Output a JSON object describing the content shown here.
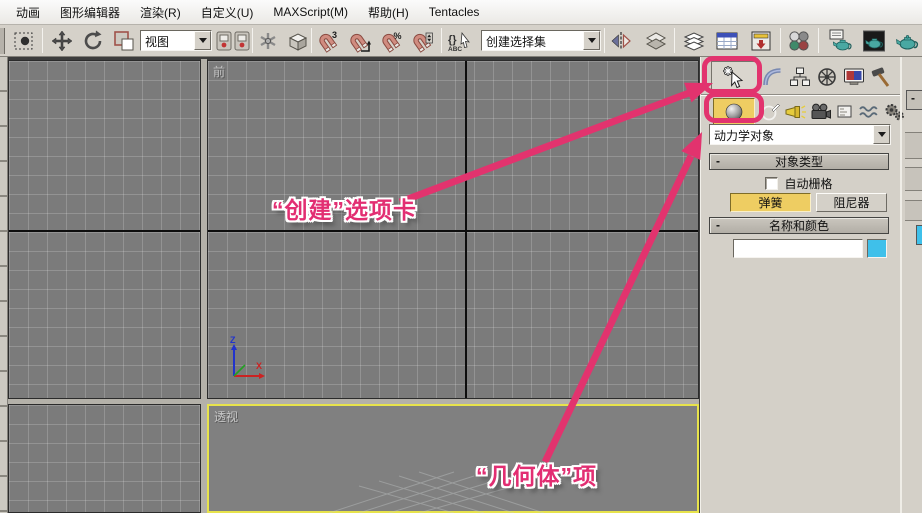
{
  "menu_bar": {
    "items": [
      "动画",
      "图形编辑器",
      "渲染(R)",
      "自定义(U)",
      "MAXScript(M)",
      "帮助(H)",
      "Tentacles"
    ]
  },
  "toolbar": {
    "view_dropdown_value": "视图",
    "selection_set_dropdown_value": "创建选择集",
    "glyphs": {
      "three": "3",
      "percent": "%",
      "braces": "{}",
      "abc": "ABC"
    },
    "icons": [
      "region-select",
      "select-and-move",
      "select-and-rotate",
      "select-and-scale",
      "use-pivot-point-center",
      "select-and-manipulate",
      "keyboard-shortcut-override",
      "3d-snap-toggle",
      "angle-snap-toggle",
      "percent-snap-toggle",
      "spinner-snap-toggle",
      "named-selection-sets",
      "mirror",
      "align",
      "layer-manager",
      "curve-editor",
      "schematic-view",
      "material-editor",
      "render-setup",
      "rendered-frame-window",
      "render-production"
    ]
  },
  "viewports": {
    "front_label": "前",
    "perspective_label": "透视",
    "axis": {
      "x": "X",
      "z": "Z"
    }
  },
  "command_panel": {
    "tabs": [
      "create",
      "modify",
      "hierarchy",
      "motion",
      "display",
      "utilities"
    ],
    "active_tab": "create",
    "categories": [
      "geometry",
      "shapes",
      "lights",
      "cameras",
      "helpers",
      "space-warps",
      "systems"
    ],
    "active_category": "geometry",
    "category_dropdown_value": "动力学对象",
    "object_type_rollout": {
      "collapse_glyph": "-",
      "title": "对象类型",
      "autogrid_label": "自动栅格",
      "autogrid_checked": false,
      "buttons": [
        {
          "label": "弹簧",
          "active": true
        },
        {
          "label": "阻尼器",
          "active": false
        }
      ]
    },
    "name_color_rollout": {
      "collapse_glyph": "-",
      "title": "名称和颜色",
      "name_value": "",
      "color_swatch": "#3FC0EA"
    },
    "right_strip": {
      "collapse_glyph": "-"
    }
  },
  "annotations": {
    "accent_color": "#E2336E",
    "create_tab_callout": "“创建”选项卡",
    "geometry_item_callout": "“几何体”项"
  }
}
